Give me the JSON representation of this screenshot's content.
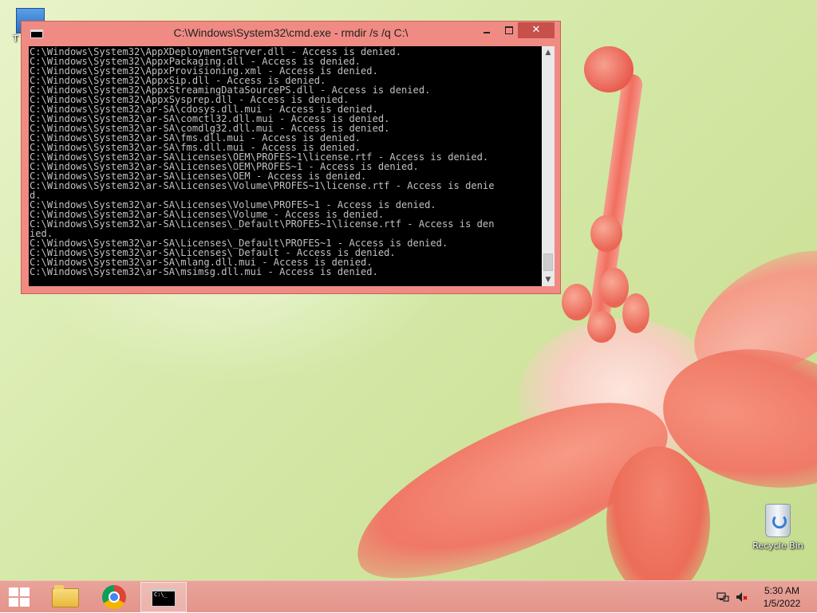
{
  "desktop": {
    "icons": [
      {
        "label": "Recycle Bin",
        "icon": "recycle-bin-icon"
      },
      {
        "label": "T",
        "icon": "computer-icon"
      }
    ]
  },
  "window": {
    "title": "C:\\Windows\\System32\\cmd.exe - rmdir  /s /q C:\\",
    "minimize_icon": "minimize-icon",
    "maximize_icon": "maximize-icon",
    "close_label": "✕",
    "accent_color": "#f08b84",
    "console_lines": [
      "C:\\Windows\\System32\\AppXDeploymentServer.dll - Access is denied.",
      "C:\\Windows\\System32\\AppxPackaging.dll - Access is denied.",
      "C:\\Windows\\System32\\AppxProvisioning.xml - Access is denied.",
      "C:\\Windows\\System32\\AppxSip.dll - Access is denied.",
      "C:\\Windows\\System32\\AppxStreamingDataSourcePS.dll - Access is denied.",
      "C:\\Windows\\System32\\AppxSysprep.dll - Access is denied.",
      "C:\\Windows\\System32\\ar-SA\\cdosys.dll.mui - Access is denied.",
      "C:\\Windows\\System32\\ar-SA\\comctl32.dll.mui - Access is denied.",
      "C:\\Windows\\System32\\ar-SA\\comdlg32.dll.mui - Access is denied.",
      "C:\\Windows\\System32\\ar-SA\\fms.dll.mui - Access is denied.",
      "C:\\Windows\\System32\\ar-SA\\fms.dll.mui - Access is denied.",
      "C:\\Windows\\System32\\ar-SA\\Licenses\\OEM\\PROFES~1\\license.rtf - Access is denied.",
      "C:\\Windows\\System32\\ar-SA\\Licenses\\OEM\\PROFES~1 - Access is denied.",
      "C:\\Windows\\System32\\ar-SA\\Licenses\\OEM - Access is denied.",
      "C:\\Windows\\System32\\ar-SA\\Licenses\\Volume\\PROFES~1\\license.rtf - Access is denie",
      "d.",
      "C:\\Windows\\System32\\ar-SA\\Licenses\\Volume\\PROFES~1 - Access is denied.",
      "C:\\Windows\\System32\\ar-SA\\Licenses\\Volume - Access is denied.",
      "C:\\Windows\\System32\\ar-SA\\Licenses\\_Default\\PROFES~1\\license.rtf - Access is den",
      "ied.",
      "C:\\Windows\\System32\\ar-SA\\Licenses\\_Default\\PROFES~1 - Access is denied.",
      "C:\\Windows\\System32\\ar-SA\\Licenses\\ Default - Access is denied.",
      "C:\\Windows\\System32\\ar-SA\\mlang.dll.mui - Access is denied.",
      "C:\\Windows\\System32\\ar-SA\\msimsg.dll.mui - Access is denied."
    ],
    "scrollbar": {
      "up_icon": "scroll-up-icon",
      "down_icon": "scroll-down-icon"
    }
  },
  "taskbar": {
    "start_icon": "windows-logo-icon",
    "apps": [
      {
        "name": "File Explorer",
        "icon": "folder-icon"
      },
      {
        "name": "Google Chrome",
        "icon": "chrome-icon"
      },
      {
        "name": "Command Prompt",
        "icon": "cmd-icon",
        "active": true,
        "glyph_text": "C:\\_"
      }
    ],
    "tray": {
      "network_icon": "network-icon",
      "volume_icon": "volume-muted-icon",
      "time": "5:30 AM",
      "date": "1/5/2022"
    }
  }
}
